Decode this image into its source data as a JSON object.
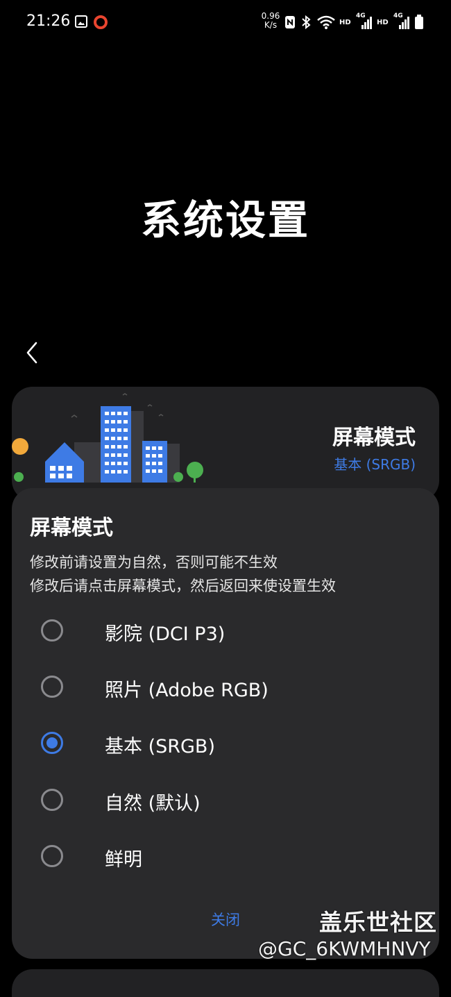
{
  "status_bar": {
    "time": "21:26",
    "net_speed_value": "0.96",
    "net_speed_unit": "K/s",
    "hd_1": "HD",
    "hd_2": "HD",
    "signal_1_label": "4G",
    "signal_2_label": "4G",
    "icons": [
      "image-icon",
      "record-ring-icon",
      "nfc-icon",
      "bluetooth-icon",
      "wifi-icon",
      "signal-icon",
      "battery-icon"
    ]
  },
  "page": {
    "title": "系统设置"
  },
  "card": {
    "title": "屏幕模式",
    "subtitle": "基本 (SRGB)"
  },
  "dialog": {
    "title": "屏幕模式",
    "message_line1": "修改前请设置为自然，否则可能不生效",
    "message_line2": "修改后请点击屏幕模式，然后返回来使设置生效",
    "options": [
      {
        "label": "影院 (DCI P3)",
        "selected": false
      },
      {
        "label": "照片 (Adobe RGB)",
        "selected": false
      },
      {
        "label": "基本 (SRGB)",
        "selected": true
      },
      {
        "label": "自然 (默认)",
        "selected": false
      },
      {
        "label": "鲜明",
        "selected": false
      }
    ],
    "close_label": "关闭"
  },
  "watermark": {
    "line1": "盖乐世社区",
    "line2": "@GC_6KWMHNVY"
  },
  "colors": {
    "accent": "#3e7be5",
    "background": "#000000",
    "card": "#222224",
    "dialog": "#2a2a2c"
  }
}
